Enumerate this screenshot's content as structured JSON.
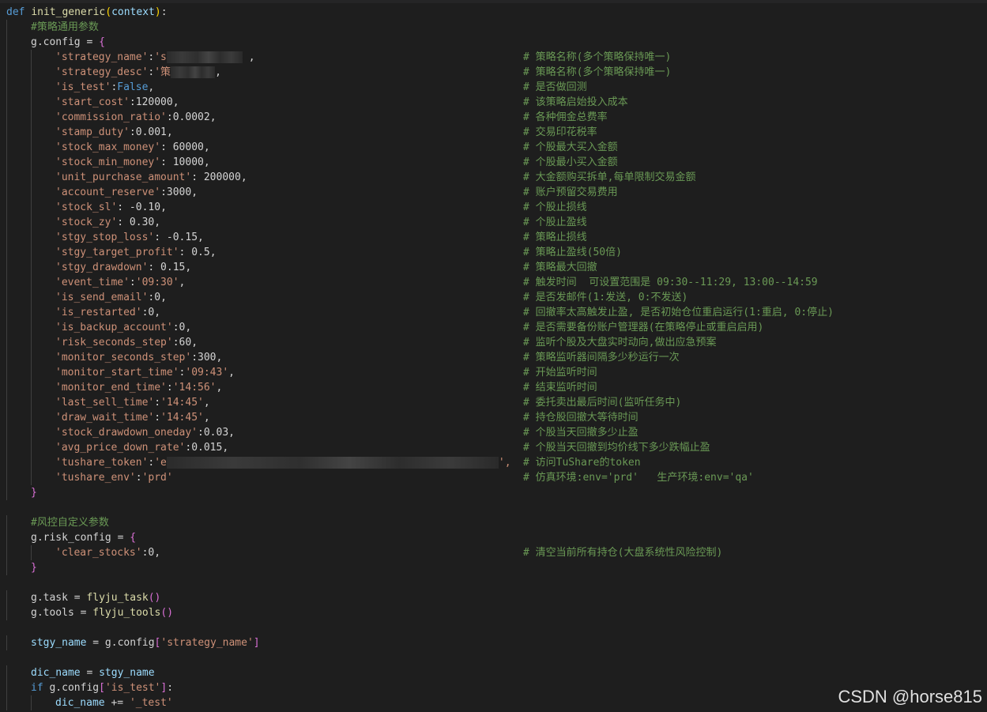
{
  "code": {
    "def_kw": "def",
    "func_name": "init_generic",
    "func_param": "context",
    "config_section_comment": "#策略通用参数",
    "config_var": "g.config",
    "config_items": [
      {
        "key": "'strategy_name'",
        "value": "'s",
        "redacted": true,
        "tail": " ,",
        "comment": "# 策略名称(多个策略保持唯一)"
      },
      {
        "key": "'strategy_desc'",
        "value": "'策",
        "redacted": true,
        "tail": ",",
        "comment": "# 策略名称(多个策略保持唯一)"
      },
      {
        "key": "'is_test'",
        "value": "False",
        "tail": ",",
        "comment": "# 是否做回测"
      },
      {
        "key": "'start_cost'",
        "value": "120000",
        "tail": ",",
        "comment": "# 该策略启始投入成本"
      },
      {
        "key": "'commission_ratio'",
        "value": "0.0002",
        "tail": ",",
        "comment": "# 各种佣金总费率"
      },
      {
        "key": "'stamp_duty'",
        "value": "0.001",
        "tail": ",",
        "comment": "# 交易印花税率"
      },
      {
        "key": "'stock_max_money'",
        "value": " 60000",
        "tail": ",",
        "comment": "# 个股最大买入金额"
      },
      {
        "key": "'stock_min_money'",
        "value": " 10000",
        "tail": ",",
        "comment": "# 个股最小买入金额"
      },
      {
        "key": "'unit_purchase_amount'",
        "value": " 200000",
        "tail": ",",
        "comment": "# 大金额购买拆单,每单限制交易金额"
      },
      {
        "key": "'account_reserve'",
        "value": "3000",
        "tail": ",",
        "comment": "# 账户预留交易费用"
      },
      {
        "key": "'stock_sl'",
        "value": " -0.10",
        "tail": ",",
        "comment": "# 个股止损线"
      },
      {
        "key": "'stock_zy'",
        "value": " 0.30",
        "tail": ",",
        "comment": "# 个股止盈线"
      },
      {
        "key": "'stgy_stop_loss'",
        "value": " -0.15",
        "tail": ",",
        "comment": "# 策略止损线"
      },
      {
        "key": "'stgy_target_profit'",
        "value": " 0.5",
        "tail": ",",
        "comment": "# 策略止盈线(50倍)"
      },
      {
        "key": "'stgy_drawdown'",
        "value": " 0.15",
        "tail": ",",
        "comment": "# 策略最大回撤"
      },
      {
        "key": "'event_time'",
        "value": "'09:30'",
        "tail": ",",
        "comment": "# 触发时间  可设置范围是 09:30--11:29, 13:00--14:59"
      },
      {
        "key": "'is_send_email'",
        "value": "0",
        "tail": ",",
        "comment": "# 是否发邮件(1:发送, 0:不发送)"
      },
      {
        "key": "'is_restarted'",
        "value": "0",
        "tail": ",",
        "comment": "# 回撤率太高触发止盈, 是否初始仓位重启运行(1:重启, 0:停止)"
      },
      {
        "key": "'is_backup_account'",
        "value": "0",
        "tail": ",",
        "comment": "# 是否需要备份账户管理器(在策略停止或重启启用)"
      },
      {
        "key": "'risk_seconds_step'",
        "value": "60",
        "tail": ",",
        "comment": "# 监听个股及大盘实时动向,做出应急预案"
      },
      {
        "key": "'monitor_seconds_step'",
        "value": "300",
        "tail": ",",
        "comment": "# 策略监听器间隔多少秒运行一次"
      },
      {
        "key": "'monitor_start_time'",
        "value": "'09:43'",
        "tail": ",",
        "comment": "# 开始监听时间"
      },
      {
        "key": "'monitor_end_time'",
        "value": "'14:56'",
        "tail": ",",
        "comment": "# 结束监听时间"
      },
      {
        "key": "'last_sell_time'",
        "value": "'14:45'",
        "tail": ",",
        "comment": "# 委托卖出最后时间(监听任务中)"
      },
      {
        "key": "'draw_wait_time'",
        "value": "'14:45'",
        "tail": ",",
        "comment": "# 持仓股回撤大等待时间"
      },
      {
        "key": "'stock_drawdown_oneday'",
        "value": "0.03",
        "tail": ",",
        "comment": "# 个股当天回撤多少止盈"
      },
      {
        "key": "'avg_price_down_rate'",
        "value": "0.015",
        "tail": ",",
        "comment": "# 个股当天回撤到均价线下多少跌幅止盈"
      },
      {
        "key": "'tushare_token'",
        "value": "'e",
        "redacted": true,
        "tail": "',",
        "comment": "# 访问TuShare的token"
      },
      {
        "key": "'tushare_env'",
        "value": "'prd'",
        "tail": "",
        "comment": "# 仿真环境:env='prd'   生产环境:env='qa'"
      }
    ],
    "risk_section_comment": "#风控自定义参数",
    "risk_var": "g.risk_config",
    "risk_items": [
      {
        "key": "'clear_stocks'",
        "value": "0",
        "tail": ",",
        "comment": "# 清空当前所有持仓(大盘系统性风险控制)"
      }
    ],
    "task_var": "g.task",
    "task_call": "flyju_task",
    "tools_var": "g.tools",
    "tools_call": "flyju_tools",
    "stgy_name_var": "stgy_name",
    "stgy_name_src": "g.config",
    "stgy_name_key": "'strategy_name'",
    "dic_name_var": "dic_name",
    "dic_name_src": "stgy_name",
    "if_kw": "if",
    "if_src": "g.config",
    "if_key": "'is_test'",
    "dic_name_suffix": "'_test'"
  },
  "watermark": "CSDN @horse815",
  "colors": {
    "background": "#1e1e1e",
    "keyword": "#569cd6",
    "function": "#dcdcaa",
    "string": "#ce9178",
    "comment": "#6a9955",
    "brace": "#ffd700",
    "paren": "#da70d6"
  }
}
